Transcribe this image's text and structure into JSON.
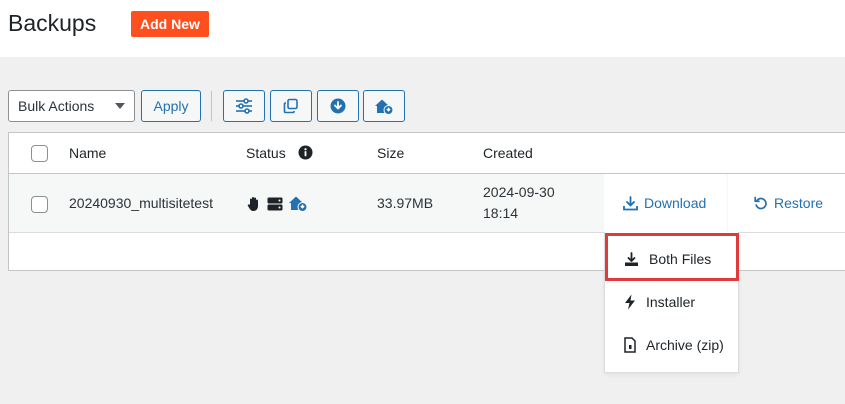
{
  "header": {
    "title": "Backups",
    "add_new_label": "Add New"
  },
  "toolbar": {
    "bulk_actions_label": "Bulk Actions",
    "apply_label": "Apply",
    "icon_buttons": [
      "sliders-icon",
      "copy-icon",
      "download-circle-icon",
      "house-lock-icon"
    ]
  },
  "table": {
    "columns": {
      "name": "Name",
      "status": "Status",
      "size": "Size",
      "created": "Created"
    },
    "rows": [
      {
        "name": "20240930_multisitetest",
        "status_icons": [
          "hand-icon",
          "server-icon",
          "house-lock-icon"
        ],
        "size": "33.97MB",
        "created_date": "2024-09-30",
        "created_time": "18:14",
        "download_label": "Download",
        "restore_label": "Restore"
      }
    ]
  },
  "download_menu": {
    "items": [
      {
        "label": "Both Files",
        "icon": "download-tray-icon"
      },
      {
        "label": "Installer",
        "icon": "bolt-icon"
      },
      {
        "label": "Archive (zip)",
        "icon": "zip-file-icon"
      }
    ]
  },
  "colors": {
    "accent": "#2271b1",
    "add_new": "#ff4f1f",
    "highlight": "#e03a3a"
  }
}
